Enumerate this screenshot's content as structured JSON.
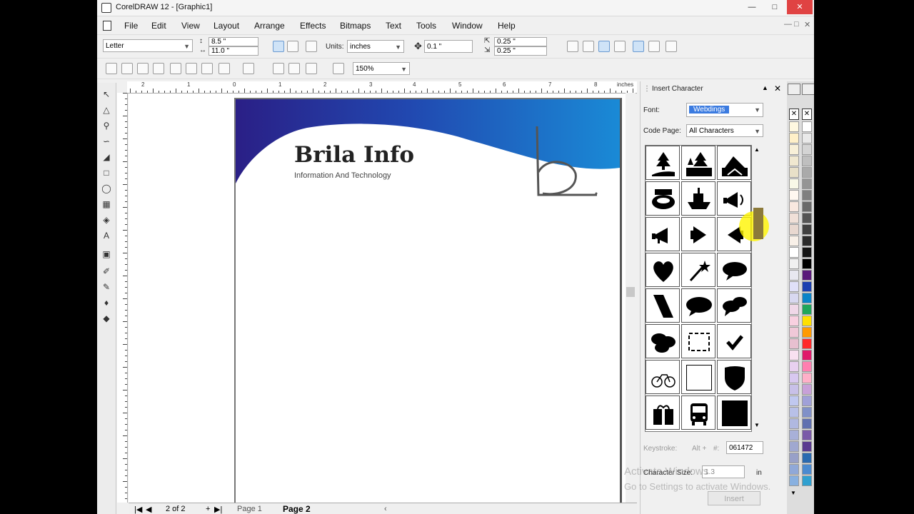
{
  "title_bar": {
    "title": "CorelDRAW 12 - [Graphic1]",
    "min": "—",
    "max": "□",
    "close": "✕"
  },
  "menu": [
    "File",
    "Edit",
    "View",
    "Layout",
    "Arrange",
    "Effects",
    "Bitmaps",
    "Text",
    "Tools",
    "Window",
    "Help"
  ],
  "mdi_controls": [
    "—",
    "□",
    "✕"
  ],
  "property_bar": {
    "paper": "Letter",
    "width": "8.5 \"",
    "height": "11.0 \"",
    "units_label": "Units:",
    "units": "inches",
    "nudge": "0.1 \"",
    "dup_x": "0.25 \"",
    "dup_y": "0.25 \""
  },
  "standard_toolbar": {
    "zoom": "150%"
  },
  "ruler": {
    "unit": "inches",
    "h_labels": [
      "2",
      "1",
      "0",
      "1",
      "2",
      "3",
      "4",
      "5",
      "6",
      "7",
      "8"
    ]
  },
  "page": {
    "brand": "Brila Info",
    "tagline": "Information And Technology"
  },
  "page_bar": {
    "counter": "2 of 2",
    "page1": "Page 1",
    "page2": "Page 2"
  },
  "docker": {
    "title": "Insert Character",
    "font_label": "Font:",
    "font_value": "Webdings",
    "code_page_label": "Code Page:",
    "code_page_value": "All Characters",
    "keystroke_label": "Keystroke:",
    "alt_label": "Alt +",
    "keystroke_value": "061472",
    "size_label": "Character Size:",
    "size_value": "1.3",
    "size_unit": "in",
    "insert_label": "Insert"
  },
  "glyphs": [
    "forest-road",
    "forest-lake",
    "mountain-road",
    "stadium",
    "ship",
    "megaphone-loud",
    "megaphone",
    "speaker-right",
    "speaker-left",
    "heart",
    "magic-wand",
    "speech-bubble",
    "rhombus",
    "speech-bubble-wide",
    "speech-bubbles",
    "speech-bubbles-many",
    "selection-frame",
    "check-mark",
    "bicycle",
    "empty-square",
    "shield",
    "gift",
    "bus-front",
    "black-square"
  ],
  "watermark": {
    "line1": "Activate Windows",
    "line2": "Go to Settings to activate Windows."
  },
  "palette_colors": [
    "#ffffff",
    "#e9e9e9",
    "#d4d4d4",
    "#bfbfbf",
    "#aaaaaa",
    "#959595",
    "#808080",
    "#6a6a6a",
    "#555555",
    "#404040",
    "#2b2b2b",
    "#151515",
    "#000000",
    "#5a1a7a",
    "#1b3fb0",
    "#0a84c8",
    "#1fa65a",
    "#ffe000",
    "#ff9a00",
    "#ff2a2a",
    "#e01a6a",
    "#ff7fb0",
    "#ffb0c8",
    "#c8a0d8",
    "#a0a0d8",
    "#8090c8",
    "#6070b0",
    "#7a5aa8",
    "#5a3a90",
    "#2a6ab0",
    "#4a8ad0",
    "#30a0d0"
  ],
  "palette_pastels": [
    "#fff8e0",
    "#fff0c8",
    "#f8f0d8",
    "#f0e8d0",
    "#e8e0c8",
    "#f8f8e8",
    "#fff8f0",
    "#f8e8e0",
    "#f0e0d8",
    "#e8d8d0",
    "#f8f0e8",
    "#ffffff",
    "#f0f0f0",
    "#e8e8f0",
    "#e0e0f8",
    "#d8d8f0",
    "#f0d8e8",
    "#f8d0e0",
    "#f0c8d8",
    "#e8c0d0",
    "#f8e0f0",
    "#e8d0f0",
    "#d8c8f0",
    "#c8c0e8",
    "#c0c8f0",
    "#b8c0e8",
    "#b0b8e0",
    "#a8b0d8",
    "#a0a8d0",
    "#98a0c8",
    "#90a8d8",
    "#88b0e0"
  ]
}
